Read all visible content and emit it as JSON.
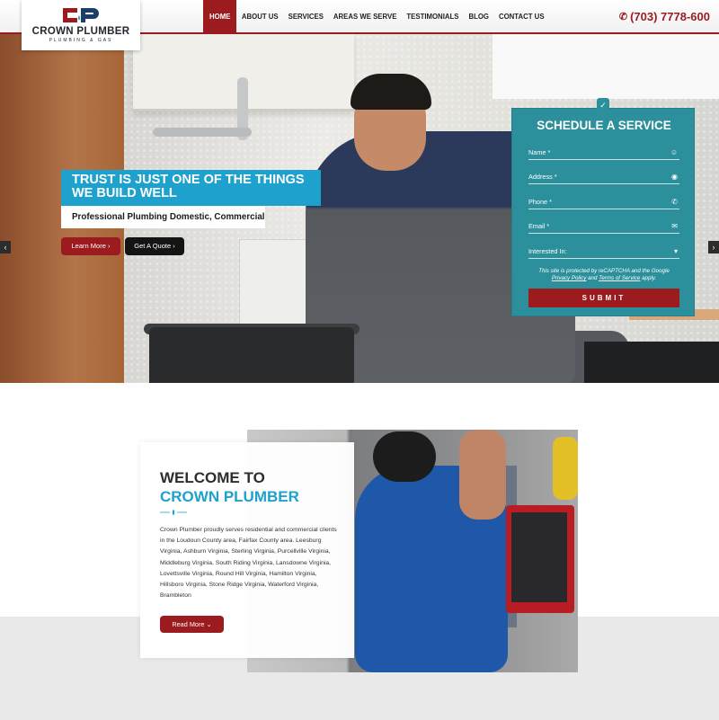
{
  "brand": {
    "name": "CROWN PLUMBER",
    "tagline": "PLUMBING & GAS",
    "colors": {
      "primary": "#9b1b1f",
      "accent": "#1ea2cd",
      "form": "#2b8f9c"
    }
  },
  "nav": {
    "items": [
      {
        "label": "HOME",
        "active": true
      },
      {
        "label": "ABOUT US",
        "active": false
      },
      {
        "label": "SERVICES",
        "active": false
      },
      {
        "label": "AREAS WE SERVE",
        "active": false
      },
      {
        "label": "TESTIMONIALS",
        "active": false
      },
      {
        "label": "BLOG",
        "active": false
      },
      {
        "label": "CONTACT US",
        "active": false
      }
    ],
    "phone": "(703) 7778-600",
    "phone_icon": "phone-ring-icon"
  },
  "hero": {
    "title": "TRUST IS JUST ONE OF THE THINGS WE BUILD WELL",
    "subtitle": "Professional Plumbing Domestic, Commercial",
    "learn_more": "Learn More",
    "get_quote": "Get A Quote",
    "prev_icon": "chevron-left-icon",
    "next_icon": "chevron-right-icon"
  },
  "form": {
    "title": "SCHEDULE A SERVICE",
    "badge_icon": "clipboard-check-icon",
    "fields": [
      {
        "placeholder": "Name *",
        "icon": "user-icon"
      },
      {
        "placeholder": "Address *",
        "icon": "map-pin-icon"
      },
      {
        "placeholder": "Phone *",
        "icon": "phone-icon"
      },
      {
        "placeholder": "Email *",
        "icon": "envelope-icon"
      },
      {
        "placeholder": "Interested In:",
        "icon": "caret-down-icon"
      }
    ],
    "recaptcha_prefix": "This site is protected by reCAPTCHA and the Google",
    "privacy_link": "Privacy Policy",
    "and": "and",
    "terms_link": "Terms of Service",
    "apply": "apply.",
    "submit": "SUBMIT"
  },
  "welcome": {
    "title_line1": "WELCOME TO",
    "title_line2": "CROWN PLUMBER",
    "body": "Crown Plumber proudly serves residential and commercial clients in the Loudoun County area, Fairfax County area. Leesburg Virginia, Ashburn Virginia, Sterling Virginia, Purcellville Virginia, Middleburg Virginia, South Riding Virginia, Lansdowne Virginia, Lovettsville Virginia, Round Hill Virginia, Hamilton Virginia, Hillsboro Virginia, Stone Ridge Virginia, Waterford Virginia, Brambleton",
    "read_more": "Read More"
  }
}
